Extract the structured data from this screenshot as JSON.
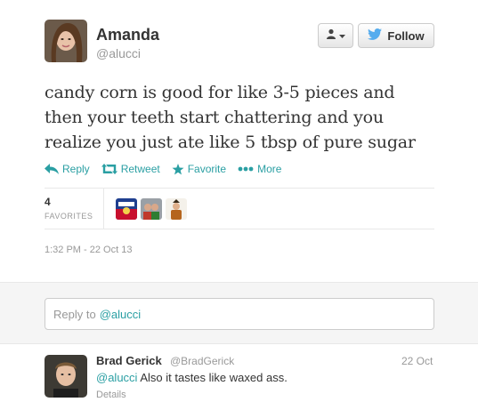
{
  "tweet": {
    "author_name": "Amanda",
    "author_handle": "@alucci",
    "text": "candy corn is good for like 3-5 pieces and then your teeth start chattering and you realize you just ate like 5 tbsp of pure sugar",
    "follow_label": "Follow",
    "actions": {
      "reply": "Reply",
      "retweet": "Retweet",
      "favorite": "Favorite",
      "more": "More"
    },
    "favorites_count": "4",
    "favorites_label": "FAVORITES",
    "timestamp": "1:32 PM - 22 Oct 13"
  },
  "reply_box": {
    "prefix": "Reply to",
    "mention": "@alucci"
  },
  "reply": {
    "author_name": "Brad Gerick",
    "author_handle": "@BradGerick",
    "date": "22 Oct",
    "mention": "@alucci",
    "text": "Also it tastes like waxed ass.",
    "details_label": "Details"
  },
  "colors": {
    "accent": "#2a9fa3",
    "twitter_blue": "#55acee",
    "muted": "#999999"
  },
  "icons": [
    "user-menu-icon",
    "twitter-bird-icon",
    "reply-icon",
    "retweet-icon",
    "star-icon",
    "more-dots-icon"
  ]
}
